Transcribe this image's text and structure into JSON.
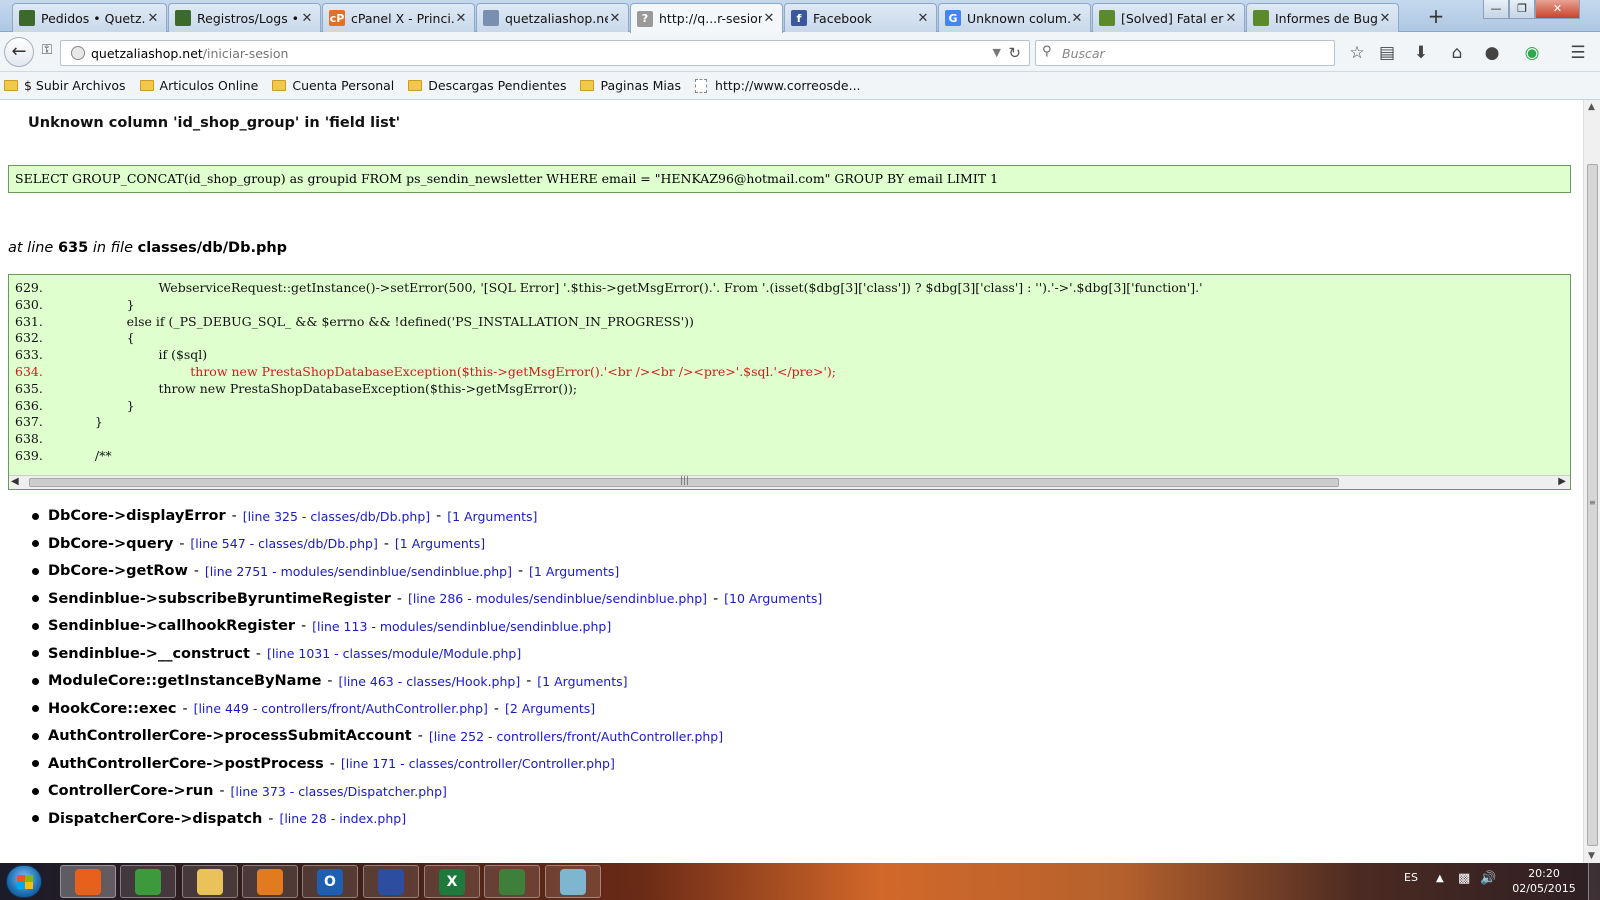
{
  "browser": {
    "tabs": [
      {
        "label": "Pedidos • Quetz...",
        "icon": "prestashop-icon"
      },
      {
        "label": "Registros/Logs • ...",
        "icon": "prestashop-icon"
      },
      {
        "label": "cPanel X - Princi...",
        "icon": "cpanel-icon"
      },
      {
        "label": "quetzaliashop.ne...",
        "icon": "phpmyadmin-icon"
      },
      {
        "label": "http://q...r-sesion",
        "icon": "question-icon",
        "active": true
      },
      {
        "label": "Facebook",
        "icon": "facebook-icon"
      },
      {
        "label": "Unknown colum...",
        "icon": "google-icon"
      },
      {
        "label": "[Solved] Fatal err...",
        "icon": "prestashop-forum-icon"
      },
      {
        "label": "Informes de Bug...",
        "icon": "prestashop-forum-icon"
      }
    ],
    "new_tab_label": "+",
    "window_controls": {
      "minimize": "—",
      "maximize": "❐",
      "close": "✕"
    },
    "url": {
      "domain": "quetzaliashop.net",
      "path": "/iniciar-sesion"
    },
    "search_placeholder": "Buscar",
    "toolbar_icons": [
      "bookmark-star-icon",
      "reading-list-icon",
      "download-icon",
      "home-icon",
      "chat-icon",
      "extension-icon",
      "menu-icon"
    ],
    "bookmarks": [
      {
        "label": "$ Subir Archivos",
        "type": "folder"
      },
      {
        "label": "Articulos Online",
        "type": "folder"
      },
      {
        "label": "Cuenta Personal",
        "type": "folder"
      },
      {
        "label": "Descargas Pendientes",
        "type": "folder"
      },
      {
        "label": "Paginas Mias",
        "type": "folder"
      },
      {
        "label": "http://www.correosde...",
        "type": "page"
      }
    ]
  },
  "error": {
    "title": "Unknown column 'id_shop_group' in 'field list'",
    "sql": "SELECT GROUP_CONCAT(id_shop_group) as groupid FROM ps_sendin_newsletter  WHERE email = \"HENKAZ96@hotmail.com\" GROUP BY email LIMIT 1",
    "location": {
      "prefix": "at line",
      "line": "635",
      "middle": "in file",
      "file": "classes/db/Db.php"
    },
    "code_lines": [
      {
        "num": "629.",
        "code": "                    WebserviceRequest::getInstance()->setError(500, '[SQL Error] '.$this->getMsgError().'. From '.(isset($dbg[3]['class']) ? $dbg[3]['class'] : '').'->'.$dbg[3]['function'].'",
        "highlight": false
      },
      {
        "num": "630.",
        "code": "            }",
        "highlight": false
      },
      {
        "num": "631.",
        "code": "            else if (_PS_DEBUG_SQL_ && $errno && !defined('PS_INSTALLATION_IN_PROGRESS'))",
        "highlight": false
      },
      {
        "num": "632.",
        "code": "            {",
        "highlight": false
      },
      {
        "num": "633.",
        "code": "                    if ($sql)",
        "highlight": false
      },
      {
        "num": "634.",
        "code": "                            throw new PrestaShopDatabaseException($this->getMsgError().'<br /><br /><pre>'.$sql.'</pre>');",
        "highlight": true
      },
      {
        "num": "635.",
        "code": "                    throw new PrestaShopDatabaseException($this->getMsgError());",
        "highlight": false
      },
      {
        "num": "636.",
        "code": "            }",
        "highlight": false
      },
      {
        "num": "637.",
        "code": "    }",
        "highlight": false
      },
      {
        "num": "638.",
        "code": "",
        "highlight": false
      },
      {
        "num": "639.",
        "code": "    /**",
        "highlight": false
      }
    ],
    "stack_trace": [
      {
        "function": "DbCore->displayError",
        "sep": "-",
        "location": "[line 325 - classes/db/Db.php]",
        "sep2": "-",
        "args": "[1 Arguments]"
      },
      {
        "function": "DbCore->query",
        "sep": "-",
        "location": "[line 547 - classes/db/Db.php]",
        "sep2": "-",
        "args": "[1 Arguments]"
      },
      {
        "function": "DbCore->getRow",
        "sep": "-",
        "location": "[line 2751 - modules/sendinblue/sendinblue.php]",
        "sep2": "-",
        "args": "[1 Arguments]"
      },
      {
        "function": "Sendinblue->subscribeByruntimeRegister",
        "sep": "-",
        "location": "[line 286 - modules/sendinblue/sendinblue.php]",
        "sep2": "-",
        "args": "[10 Arguments]"
      },
      {
        "function": "Sendinblue->callhookRegister",
        "sep": "-",
        "location": "[line 113 - modules/sendinblue/sendinblue.php]",
        "sep2": null,
        "args": null
      },
      {
        "function": "Sendinblue->__construct",
        "sep": "-",
        "location": "[line 1031 - classes/module/Module.php]",
        "sep2": null,
        "args": null
      },
      {
        "function": "ModuleCore::getInstanceByName",
        "sep": "-",
        "location": "[line 463 - classes/Hook.php]",
        "sep2": "-",
        "args": "[1 Arguments]"
      },
      {
        "function": "HookCore::exec",
        "sep": "-",
        "location": "[line 449 - controllers/front/AuthController.php]",
        "sep2": "-",
        "args": "[2 Arguments]"
      },
      {
        "function": "AuthControllerCore->processSubmitAccount",
        "sep": "-",
        "location": "[line 252 - controllers/front/AuthController.php]",
        "sep2": null,
        "args": null
      },
      {
        "function": "AuthControllerCore->postProcess",
        "sep": "-",
        "location": "[line 171 - classes/controller/Controller.php]",
        "sep2": null,
        "args": null
      },
      {
        "function": "ControllerCore->run",
        "sep": "-",
        "location": "[line 373 - classes/Dispatcher.php]",
        "sep2": null,
        "args": null
      },
      {
        "function": "DispatcherCore->dispatch",
        "sep": "-",
        "location": "[line 28 - index.php]",
        "sep2": null,
        "args": null
      }
    ]
  },
  "taskbar": {
    "apps": [
      {
        "name": "firefox-icon",
        "color": "#e8611c",
        "active": true
      },
      {
        "name": "chrome-icon",
        "color": "#3c9a3c"
      },
      {
        "name": "explorer-icon",
        "color": "#e9c35a"
      },
      {
        "name": "media-player-icon",
        "color": "#e27b1f"
      },
      {
        "name": "outlook-icon",
        "color": "#1c5fb3",
        "glyph": "O"
      },
      {
        "name": "save-disk-icon",
        "color": "#2d4da0"
      },
      {
        "name": "excel-icon",
        "color": "#1e7a3c",
        "glyph": "X"
      },
      {
        "name": "globe-app-icon",
        "color": "#3f7f3a"
      },
      {
        "name": "notebook-icon",
        "color": "#7fb6cf"
      }
    ],
    "language": "ES",
    "tray_up": "▲",
    "time": "20:20",
    "date": "02/05/2015"
  }
}
